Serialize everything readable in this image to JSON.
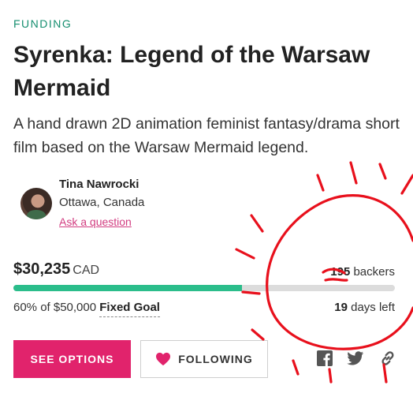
{
  "project": {
    "category": "FUNDING",
    "title": "Syrenka: Legend of the Warsaw Mermaid",
    "blurb": "A hand drawn 2D animation feminist fantasy/drama short film based on the Warsaw Mermaid legend."
  },
  "creator": {
    "name": "Tina Nawrocki",
    "location": "Ottawa, Canada",
    "ask_link": "Ask a question"
  },
  "funding": {
    "pledged": "$30,235",
    "currency": "CAD",
    "backers_count": "195",
    "backers_label": "backers",
    "goal_text": "60% of $50,000",
    "goal_type": "Fixed Goal",
    "days_count": "19",
    "days_label": "days left",
    "progress_percent": 60
  },
  "actions": {
    "options_label": "SEE OPTIONS",
    "following_label": "FOLLOWING"
  },
  "icons": {
    "follow": "heart-icon",
    "share": [
      "facebook-icon",
      "twitter-icon",
      "link-icon"
    ]
  },
  "colors": {
    "category": "#158e6f",
    "accent": "#e1236c",
    "progress": "#2bbd8b",
    "annotation": "#e8101c"
  }
}
